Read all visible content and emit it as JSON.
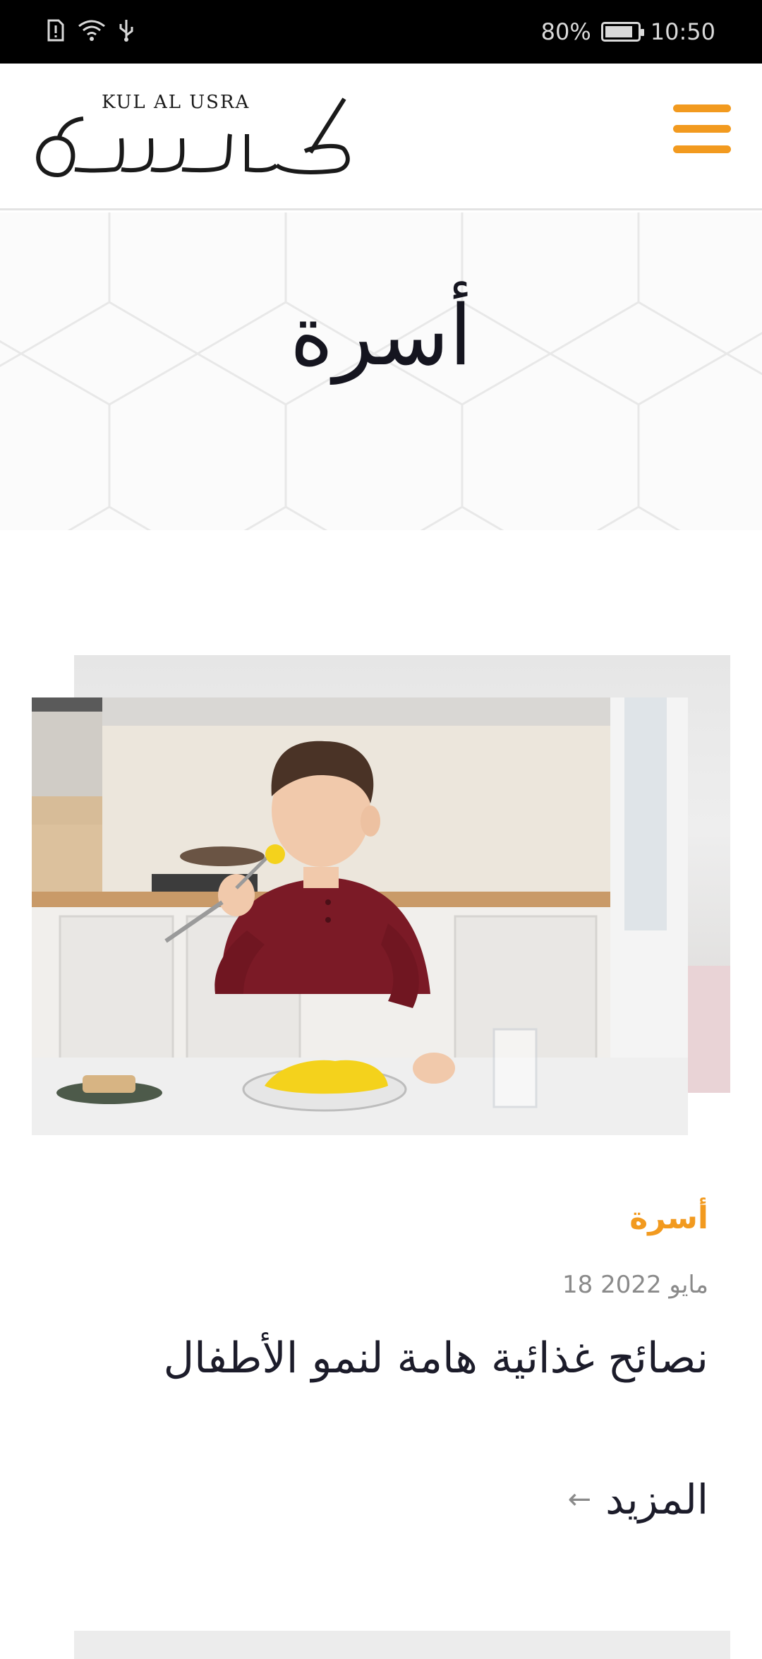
{
  "status_bar": {
    "battery": "80%",
    "time": "10:50",
    "icons": [
      "sim-alert-icon",
      "wifi-icon",
      "usb-icon",
      "battery-charging-icon"
    ]
  },
  "header": {
    "logo_text_latin": "KUL AL USRA",
    "logo_text_arabic": "كل الاسرة",
    "menu_icon": "hamburger-menu-icon",
    "accent_color": "#f29a1f"
  },
  "hero": {
    "title": "أسرة"
  },
  "article": {
    "category": "أسرة",
    "date": "18 مايو 2022",
    "title": "نصائح غذائية هامة لنمو الأطفال",
    "more_label": "المزيد",
    "more_arrow": "←"
  }
}
